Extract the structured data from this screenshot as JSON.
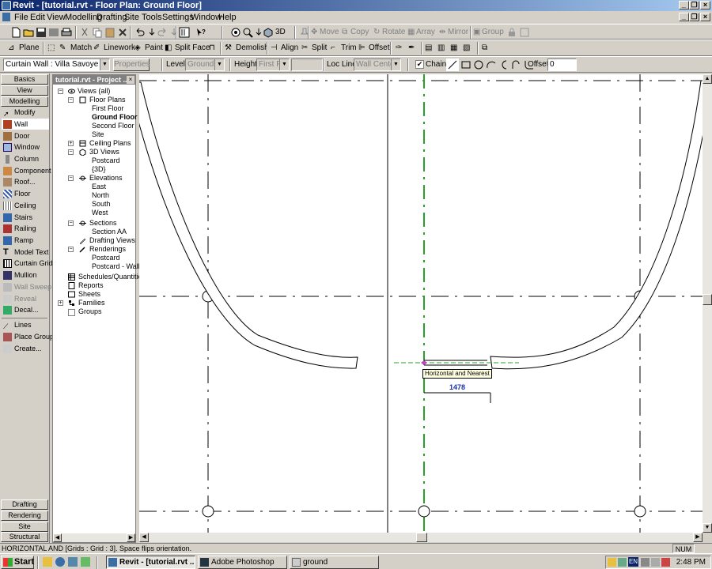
{
  "window": {
    "title": "Revit - [tutorial.rvt - Floor Plan: Ground Floor]"
  },
  "menu": [
    "File",
    "Edit",
    "View",
    "Modelling",
    "Drafting",
    "Site",
    "Tools",
    "Settings",
    "Window",
    "Help"
  ],
  "toolbar2": {
    "plane": "Plane",
    "match": "Match",
    "linework": "Linework",
    "paint": "Paint",
    "split_face": "Split Face",
    "demolish": "Demolish",
    "align": "Align",
    "split": "Split",
    "trim": "Trim",
    "offset": "Offset"
  },
  "toolbar1": {
    "view3d": "3D",
    "move": "Move",
    "copy": "Copy",
    "rotate": "Rotate",
    "array": "Array",
    "mirror": "Mirror",
    "group": "Group"
  },
  "options_bar": {
    "type_selector": "Curtain Wall : Villa Savoye",
    "properties_label": "Properties",
    "level_label": "Level:",
    "level_value": "Ground Flc",
    "height_label": "Height:",
    "height_value": "First Flo",
    "loc_line_label": "Loc Line:",
    "loc_line_value": "Wall Centerlin",
    "chain_label": "Chain",
    "offset_label": "Offset:",
    "offset_value": "0"
  },
  "design_bar": {
    "tabs_top": [
      "Basics",
      "View",
      "Modelling"
    ],
    "items": [
      "Modify",
      "Wall",
      "Door",
      "Window",
      "Column",
      "Component",
      "Roof...",
      "Floor",
      "Ceiling",
      "Stairs",
      "Railing",
      "Ramp",
      "Model Text",
      "Curtain Grid",
      "Mullion",
      "Wall Sweep",
      "Reveal",
      "Decal...",
      "Lines",
      "Place Group",
      "Create..."
    ],
    "tabs_bottom": [
      "Drafting",
      "Rendering",
      "Site",
      "Structural"
    ]
  },
  "project_browser": {
    "title": "tutorial.rvt - Project ...",
    "nodes": [
      "Views (all)",
      "Floor Plans",
      "First Floor",
      "Ground Floor",
      "Second Floor",
      "Site",
      "Ceiling Plans",
      "3D Views",
      "Postcard",
      "{3D}",
      "Elevations",
      "East",
      "North",
      "South",
      "West",
      "Sections",
      "Section AA",
      "Drafting Views",
      "Renderings",
      "Postcard",
      "Postcard - Wall:",
      "Schedules/Quantities",
      "Reports",
      "Sheets",
      "Families",
      "Groups"
    ]
  },
  "canvas": {
    "tooltip": "Horizontal and Nearest",
    "dimension": "1478"
  },
  "status_bar": {
    "message": "HORIZONTAL AND [Grids : Grid : 3].  Space flips orientation.",
    "num": "NUM"
  },
  "taskbar": {
    "start": "Start",
    "tasks": [
      "Revit - [tutorial.rvt ...",
      "Adobe Photoshop",
      "ground"
    ],
    "language": "EN",
    "clock": "2:48 PM"
  },
  "colors": {
    "title_start": "#0a246a",
    "title_end": "#a6caf0",
    "face": "#d4d0c8",
    "grid_green": "#2aa02a",
    "dim_blue": "#1a33a8"
  }
}
